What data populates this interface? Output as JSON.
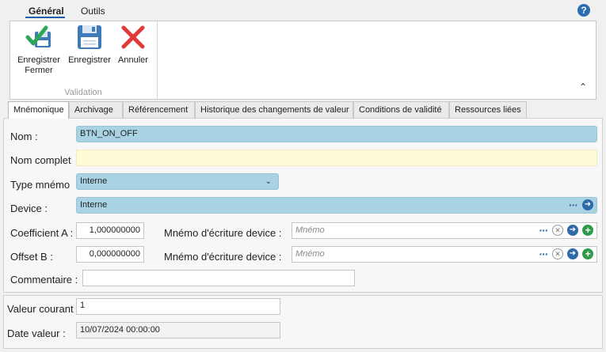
{
  "ribbon": {
    "tabs": [
      "Général",
      "Outils"
    ],
    "help_icon": "help-icon",
    "buttons": [
      {
        "label": "Enregistrer\nFermer",
        "icon": "save-close-icon"
      },
      {
        "label": "Enregistrer",
        "icon": "save-icon"
      },
      {
        "label": "Annuler",
        "icon": "cancel-icon"
      }
    ],
    "group_label": "Validation",
    "collapse_glyph": "^"
  },
  "page_tabs": [
    "Mnémonique",
    "Archivage",
    "Référencement",
    "Historique des changements de valeur",
    "Conditions de validité",
    "Ressources liées"
  ],
  "form": {
    "nom": {
      "label": "Nom :",
      "value": "BTN_ON_OFF"
    },
    "nom_complet": {
      "label": "Nom complet",
      "value": ""
    },
    "type_mnemo": {
      "label": "Type mnémo",
      "value": "Interne"
    },
    "device": {
      "label": "Device :",
      "value": "Interne"
    },
    "coefficient_a": {
      "label": "Coefficient A :",
      "value": "1,000000000"
    },
    "offset_b": {
      "label": "Offset B :",
      "value": "0,000000000"
    },
    "mnemo_ecriture_1": {
      "label": "Mnémo d'écriture device :",
      "placeholder": "Mnémo"
    },
    "mnemo_ecriture_2": {
      "label": "Mnémo d'écriture device :",
      "placeholder": "Mnémo"
    },
    "commentaire": {
      "label": "Commentaire :",
      "value": ""
    }
  },
  "bottom": {
    "valeur_courante": {
      "label": "Valeur courant",
      "value": "1"
    },
    "date_valeur": {
      "label": "Date valeur :",
      "value": "10/07/2024 00:00:00"
    }
  },
  "colors": {
    "accent": "#1e5fa8",
    "field_blue": "#a9d3e4",
    "field_yellow": "#fefbd6",
    "cancel_red": "#e03a3a",
    "check_green": "#2fa55a"
  }
}
